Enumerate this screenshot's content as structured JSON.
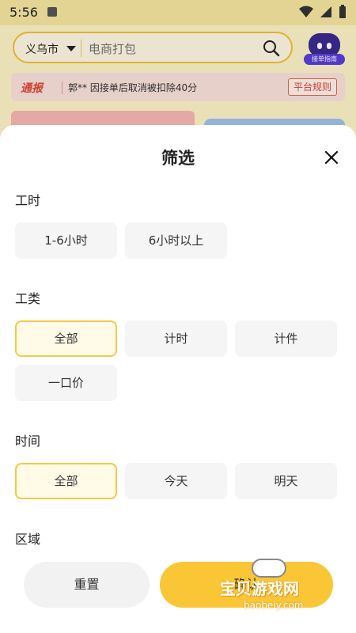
{
  "status_bar": {
    "time": "5:56"
  },
  "header": {
    "city": "义乌市",
    "search_placeholder": "电商打包",
    "guide_label": "接单指南"
  },
  "notice": {
    "tag": "通报",
    "text": "郭** 因接单后取消被扣除40分",
    "rules_label": "平台规则"
  },
  "sheet": {
    "title": "筛选",
    "sections": {
      "work_hours": {
        "label": "工时",
        "options": [
          "1-6小时",
          "6小时以上"
        ]
      },
      "work_type": {
        "label": "工类",
        "options": [
          "全部",
          "计时",
          "计件",
          "一口价"
        ],
        "selected": "全部"
      },
      "time": {
        "label": "时间",
        "options": [
          "全部",
          "今天",
          "明天"
        ],
        "selected": "全部"
      },
      "area": {
        "label": "区域"
      }
    },
    "reset_label": "重置",
    "confirm_label": "确认"
  },
  "watermark": {
    "text": "宝贝游戏网",
    "url": "baobeiy.com"
  },
  "colors": {
    "accent": "#fbc636",
    "selected_border": "#f5c944",
    "notice_red": "#e0452f"
  }
}
